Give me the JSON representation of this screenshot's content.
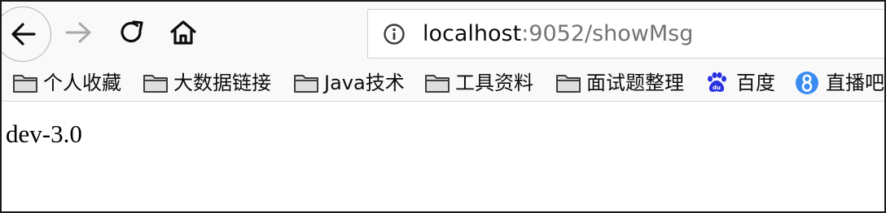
{
  "toolbar": {
    "back_icon": "arrow-left-icon",
    "forward_icon": "arrow-right-icon",
    "reload_icon": "reload-icon",
    "home_icon": "home-icon"
  },
  "urlbar": {
    "info_icon": "info-icon",
    "host": "localhost",
    "path": ":9052/showMsg"
  },
  "bookmarks": [
    {
      "label": "个人收藏",
      "icon": "folder-icon"
    },
    {
      "label": "大数据链接",
      "icon": "folder-icon"
    },
    {
      "label": "Java技术",
      "icon": "folder-icon"
    },
    {
      "label": "工具资料",
      "icon": "folder-icon"
    },
    {
      "label": "面试题整理",
      "icon": "folder-icon"
    },
    {
      "label": "百度",
      "icon": "baidu-paw-icon"
    },
    {
      "label": "直播吧",
      "icon": "zhibo8-icon"
    }
  ],
  "page": {
    "body_text": "dev-3.0"
  },
  "colors": {
    "toolbar_bg": "#f9f9fa",
    "url_host": "#0c0c0d",
    "url_path": "#737373",
    "baidu_blue": "#2932e1",
    "zhibo8_blue": "#3b8cf0"
  }
}
